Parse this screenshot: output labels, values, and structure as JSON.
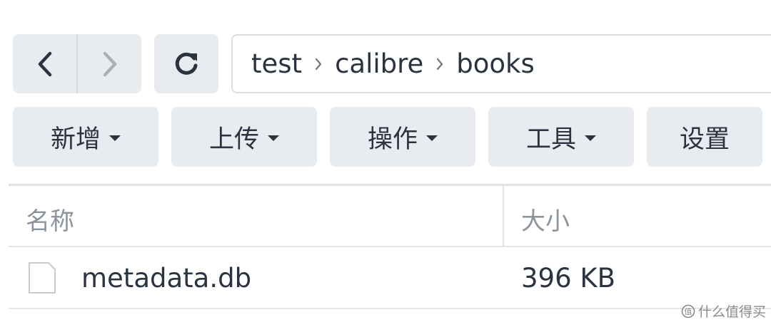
{
  "nav": {
    "back_icon": "chevron-left-icon",
    "forward_icon": "chevron-right-icon",
    "refresh_icon": "refresh-icon"
  },
  "breadcrumb": [
    "test",
    "calibre",
    "books"
  ],
  "toolbar": {
    "create_label": "新增",
    "upload_label": "上传",
    "action_label": "操作",
    "tools_label": "工具",
    "settings_label": "设置"
  },
  "table": {
    "columns": [
      "名称",
      "大小"
    ],
    "rows": [
      {
        "name": "metadata.db",
        "size": "396 KB",
        "icon": "file-icon"
      }
    ]
  },
  "watermark": {
    "text": "什么值得买"
  },
  "colors": {
    "button_bg": "#e8ecf0",
    "text": "#2b3340",
    "muted_text": "#8d949c",
    "border": "#d9dee3"
  }
}
